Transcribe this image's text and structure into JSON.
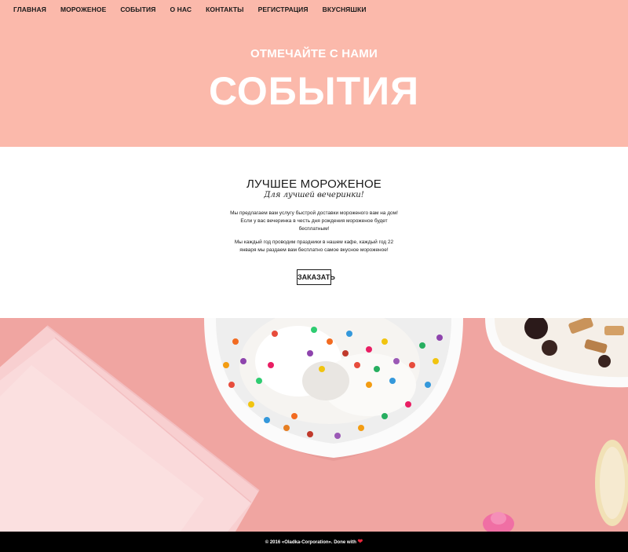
{
  "nav": {
    "items": [
      {
        "label": "ГЛАВНАЯ"
      },
      {
        "label": "МОРОЖЕНОЕ"
      },
      {
        "label": "СОБЫТИЯ"
      },
      {
        "label": "О НАС"
      },
      {
        "label": "КОНТАКТЫ"
      },
      {
        "label": "РЕГИСТРАЦИЯ"
      },
      {
        "label": "ВКУСНЯШКИ"
      }
    ]
  },
  "hero": {
    "subtitle": "ОТМЕЧАЙТЕ С НАМИ",
    "title": "СОБЫТИЯ",
    "background_color": "#fbb9ab"
  },
  "content": {
    "title": "ЛУЧШЕЕ МОРОЖЕНОЕ",
    "script_subtitle": "Для лучшей вечеринки!",
    "paragraph1": "Мы предлагаем вам услугу быстрой доставки мороженого вам на дом! Если у вас вечеринка в честь дня рождения мороженое будет бесплатным!",
    "paragraph2": "Мы каждый год проводим праздники в нашем кафе, каждый год 22 января мы раздаем вам бесплатно самое вкусное мороженое!",
    "order_button": "ЗАКАЗАТЬ"
  },
  "photo": {
    "background_color": "#f1a6a2"
  },
  "footer": {
    "text": "© 2016 «Oladka-Corporation». Done with",
    "heart_icon": "heart-icon",
    "heart_color": "#e8263a"
  }
}
